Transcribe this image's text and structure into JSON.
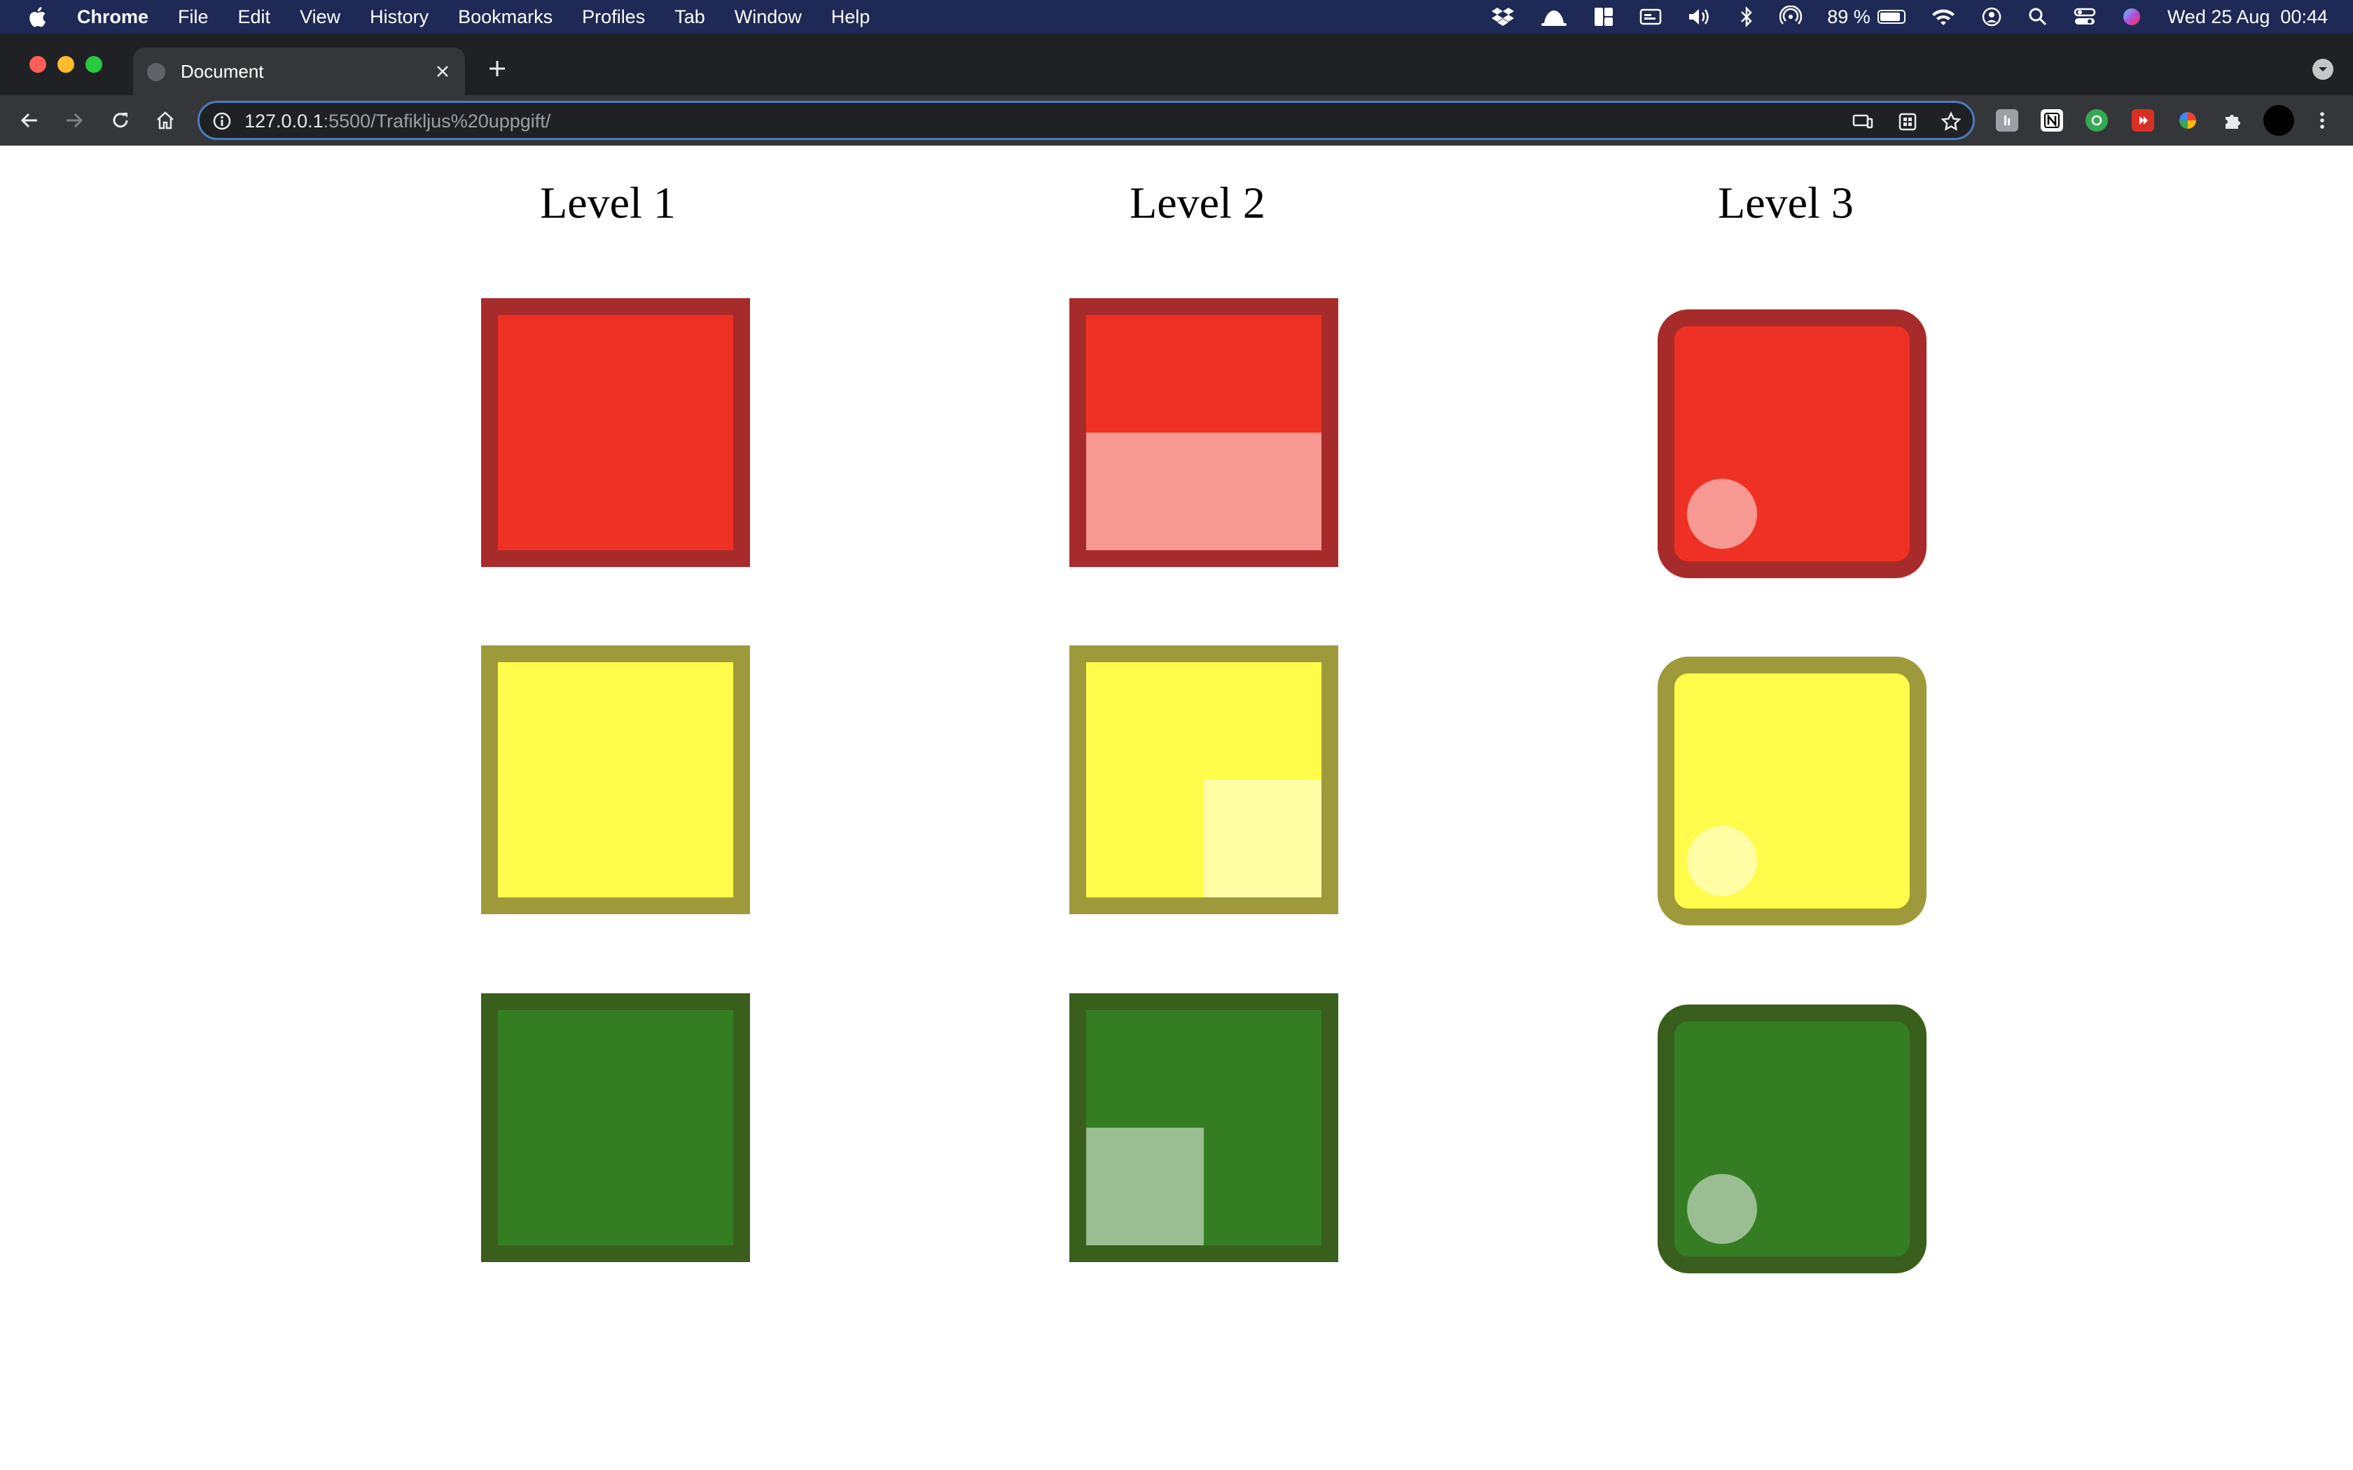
{
  "menubar": {
    "app_name": "Chrome",
    "items": [
      "File",
      "Edit",
      "View",
      "History",
      "Bookmarks",
      "Profiles",
      "Tab",
      "Window",
      "Help"
    ],
    "battery_percent": "89 %",
    "battery_level": 0.89,
    "clock": "Wed 25 Aug  00:44"
  },
  "browser": {
    "tab_title": "Document",
    "url_host": "127.0.0.1",
    "url_rest": ":5500/Trafikljus%20uppgift/"
  },
  "page": {
    "levels": [
      {
        "title": "Level 1",
        "lights": [
          {
            "color": "red"
          },
          {
            "color": "yellow"
          },
          {
            "color": "green"
          }
        ]
      },
      {
        "title": "Level 2",
        "lights": [
          {
            "color": "red",
            "highlight": "bottom-half"
          },
          {
            "color": "yellow",
            "highlight": "bottom-right-quarter"
          },
          {
            "color": "green",
            "highlight": "bottom-left-quarter"
          }
        ]
      },
      {
        "title": "Level 3",
        "lights": [
          {
            "color": "red",
            "highlight": "bottom-left-dot"
          },
          {
            "color": "yellow",
            "highlight": "bottom-left-dot"
          },
          {
            "color": "green",
            "highlight": "bottom-left-dot"
          }
        ]
      }
    ]
  },
  "colors": {
    "red_fill": "#ee3124",
    "red_border": "#a82b2b",
    "yellow_fill": "#fffc4b",
    "yellow_border": "#9e9a3b",
    "green_fill": "#357d22",
    "green_border": "#3a5f1c",
    "menubar_bg": "#1e2a55",
    "omnibox_focus": "#4a7bbf"
  }
}
